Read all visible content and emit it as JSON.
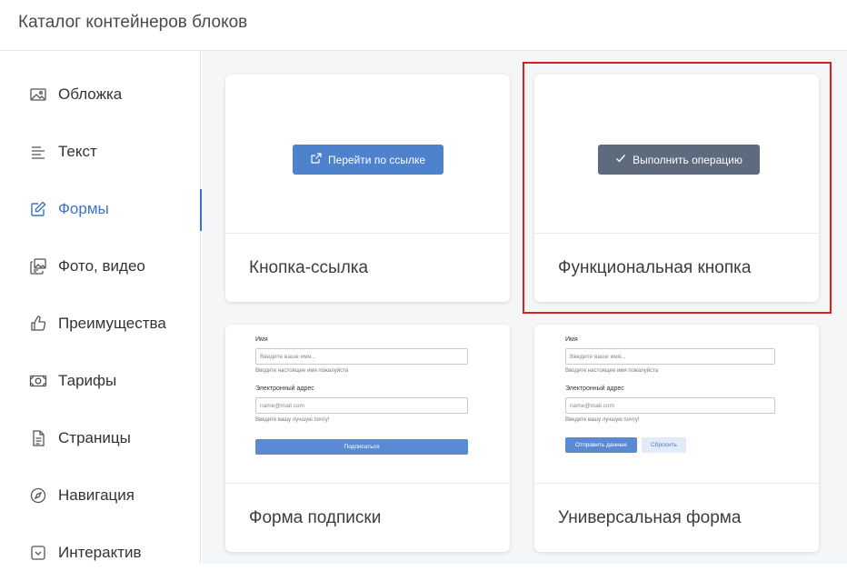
{
  "header": {
    "title": "Каталог контейнеров блоков"
  },
  "sidebar": {
    "items": [
      {
        "label": "Обложка",
        "icon": "image-icon"
      },
      {
        "label": "Текст",
        "icon": "text-lines-icon"
      },
      {
        "label": "Формы",
        "icon": "edit-form-icon",
        "active": true
      },
      {
        "label": "Фото, видео",
        "icon": "gallery-icon"
      },
      {
        "label": "Преимущества",
        "icon": "thumbs-up-icon"
      },
      {
        "label": "Тарифы",
        "icon": "banknote-icon"
      },
      {
        "label": "Страницы",
        "icon": "document-icon"
      },
      {
        "label": "Навигация",
        "icon": "compass-icon"
      },
      {
        "label": "Интерактив",
        "icon": "checkbox-icon"
      }
    ]
  },
  "cards": [
    {
      "title": "Кнопка-ссылка",
      "button_label": "Перейти по ссылке"
    },
    {
      "title": "Функциональная кнопка",
      "button_label": "Выполнить операцию"
    },
    {
      "title": "Форма подписки",
      "form": {
        "name_label": "Имя",
        "name_placeholder": "Введите ваше имя...",
        "name_hint": "Вводите настоящее имя пожалуйста",
        "email_label": "Электронный адрес",
        "email_placeholder": "name@mail.com",
        "email_hint": "Введите вашу лучшую почту!",
        "submit_label": "Подписаться"
      }
    },
    {
      "title": "Универсальная форма",
      "form": {
        "name_label": "Имя",
        "name_placeholder": "Введите ваше имя...",
        "name_hint": "Вводите настоящее имя пожалуйста",
        "email_label": "Электронный адрес",
        "email_placeholder": "name@mail.com",
        "email_hint": "Введите вашу лучшую почту!",
        "submit_label": "Отправить данные",
        "reset_label": "Сбросить"
      }
    }
  ],
  "colors": {
    "accent": "#3d72c8",
    "link_button": "#4f82cc",
    "func_button": "#5e6b7e",
    "highlight": "#d82020"
  }
}
